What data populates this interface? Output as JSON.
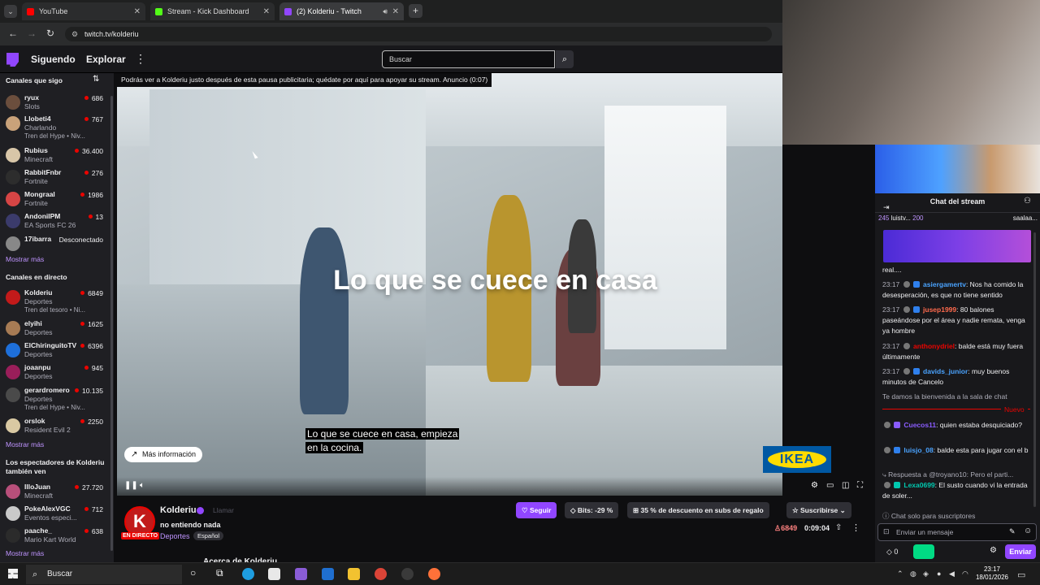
{
  "browser": {
    "tabs": [
      {
        "label": "YouTube",
        "color": "#ff0000"
      },
      {
        "label": "Stream - Kick Dashboard",
        "color": "#53fc18"
      },
      {
        "label": "(2) Kolderiu - Twitch",
        "color": "#9146ff"
      }
    ],
    "url": "twitch.tv/kolderiu"
  },
  "nav": {
    "following": "Siguendo",
    "explore": "Explorar",
    "search_placeholder": "Buscar"
  },
  "sidebar": {
    "followed_title": "Canales que sigo",
    "followed": [
      {
        "name": "ryux",
        "game": "Slots",
        "viewers": "686",
        "color": "#6b4e3d"
      },
      {
        "name": "Llobeti4",
        "game": "Charlando",
        "extra": "Tren del Hype • Niv...",
        "viewers": "767",
        "color": "#c9a27a"
      },
      {
        "name": "Rubius",
        "game": "Minecraft",
        "viewers": "36.400",
        "color": "#d8c6a8"
      },
      {
        "name": "RabbitFnbr",
        "game": "Fortnite",
        "viewers": "276",
        "color": "#2d2d2d"
      },
      {
        "name": "Mongraal",
        "game": "Fortnite",
        "viewers": "1986",
        "color": "#d64545"
      },
      {
        "name": "AndoniIPM",
        "game": "EA Sports FC 26",
        "viewers": "13",
        "color": "#3b3b6b"
      },
      {
        "name": "17ibarra",
        "status": "Desconectado",
        "color": "#888888"
      }
    ],
    "show_more_1": "Mostrar más",
    "live_title": "Canales en directo",
    "live": [
      {
        "name": "Kolderiu",
        "game": "Deportes",
        "extra": "Tren del tesoro • Ni...",
        "viewers": "6849",
        "color": "#c21a1a"
      },
      {
        "name": "elyihi",
        "game": "Deportes",
        "viewers": "1625",
        "color": "#a77b54"
      },
      {
        "name": "ElChiringuitoTV",
        "game": "Deportes",
        "viewers": "6396",
        "color": "#1e6fd9"
      },
      {
        "name": "joaanpu",
        "game": "Deportes",
        "viewers": "945",
        "color": "#9a1e5a"
      },
      {
        "name": "gerardromero",
        "game": "Deportes",
        "extra": "Tren del Hype • Niv...",
        "viewers": "10.135",
        "color": "#4a4a4a"
      },
      {
        "name": "orslok",
        "game": "Resident Evil 2",
        "viewers": "2250",
        "color": "#d9c9a3"
      }
    ],
    "show_more_2": "Mostrar más",
    "viewers_title": "Los espectadores de Kolderiu también ven",
    "also": [
      {
        "name": "IlloJuan",
        "game": "Minecraft",
        "viewers": "27.720",
        "color": "#b84f7a"
      },
      {
        "name": "PokeAlexVGC",
        "game": "Eventos especi...",
        "viewers": "712",
        "color": "#c9c9c9"
      },
      {
        "name": "paache_",
        "game": "Mario Kart World",
        "viewers": "638",
        "color": "#2b2b2b"
      }
    ],
    "show_more_3": "Mostrar más"
  },
  "video": {
    "ad_notice": "Podrás ver a Kolderiu justo después de esta pausa publicitaria; quédate por aquí para apoyar su stream. Anuncio (0:07)",
    "title_overlay": "Lo que se cuece en casa",
    "subtitle_1": "Lo que se cuece en casa, empieza",
    "subtitle_2": "en la cocina.",
    "more_info": "Más información",
    "brand": "IKEA"
  },
  "channel": {
    "name": "Kolderiu",
    "call": "Llamar",
    "live_badge": "EN DIRECTO",
    "title": "no entiendo nada",
    "category": "Deportes",
    "language": "Español",
    "follow": "Seguir",
    "bits": "Bits: -29 %",
    "sub_discount": "35 % de descuento en subs de regalo",
    "subscribe": "Suscribirse",
    "viewers": "6849",
    "uptime": "0:09:04",
    "about": "Acerca de Kolderiu"
  },
  "chat": {
    "title": "Chat del stream",
    "gifters_1": "245",
    "gifters_1_name": "luistv...",
    "gifters_2": "200",
    "gifters_3": "saalaa...",
    "truncated": "real....",
    "messages": [
      {
        "time": "23:17",
        "user": "asiergamertv",
        "color": "#4aa3ff",
        "text": ": Nos ha comido la desesperación, es que no tiene sentido"
      },
      {
        "time": "23:17",
        "user": "jusep1999",
        "color": "#ff6a4d",
        "text": ": 80 balones paseándose por el área y nadie remata, venga ya hombre"
      },
      {
        "time": "23:17",
        "user": "anthonydriel",
        "color": "#eb0400",
        "text": ": balde está muy fuera últimamente"
      },
      {
        "time": "23:17",
        "user": "davids_junior",
        "color": "#4aa3ff",
        "text": ": muy buenos minutos de Cancelo"
      }
    ],
    "welcome": "Te damos la bienvenida a la sala de chat",
    "new_label": "Nuevo",
    "messages_2": [
      {
        "user": "Cuecos11",
        "color": "#8a5cff",
        "text": ": quien estaba desquiciado?"
      },
      {
        "user": "luisjo_08",
        "color": "#4aa3ff",
        "text": ": balde esta para jugar con el b"
      }
    ],
    "reply_to": "Respuesta a @troyano10: Pero el parti...",
    "reply_user": "Lexa0699",
    "reply_color": "#00c8af",
    "reply_text": ": El susto cuando vi la entrada de soler...",
    "subs_only": "Chat solo para suscriptores",
    "input_placeholder": "Enviar un mensaje",
    "bits_balance": "0",
    "send": "Enviar"
  },
  "taskbar": {
    "search": "Buscar",
    "time": "23:17",
    "date": "18/01/2026"
  }
}
